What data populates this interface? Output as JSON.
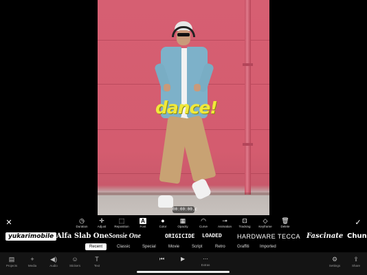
{
  "preview": {
    "overlay_text": "dance!",
    "timecode": "00:00:00.c",
    "colors": {
      "wall": "#d65f72",
      "overlay_text": "#f1e93a"
    }
  },
  "toolbar": {
    "close_icon": "close-icon",
    "done_icon": "checkmark-icon",
    "tools": [
      {
        "label": "Duration",
        "icon": "clock-icon",
        "glyph": "◷"
      },
      {
        "label": "Adjust",
        "icon": "move-icon",
        "glyph": "✛"
      },
      {
        "label": "Reposition",
        "icon": "crop-icon",
        "glyph": "⬚"
      },
      {
        "label": "Font",
        "icon": "font-icon",
        "glyph": "A"
      },
      {
        "label": "Color",
        "icon": "droplet-icon",
        "glyph": "●"
      },
      {
        "label": "Opacity",
        "icon": "checkerboard-icon",
        "glyph": "▦"
      },
      {
        "label": "Curve",
        "icon": "curve-icon",
        "glyph": "◠"
      },
      {
        "label": "Animation",
        "icon": "toggle-icon",
        "glyph": "⊸"
      },
      {
        "label": "Tracking",
        "icon": "tracking-icon",
        "glyph": "⊡"
      },
      {
        "label": "Keyframe",
        "icon": "tag-icon",
        "glyph": "◇"
      },
      {
        "label": "Delete",
        "icon": "trash-icon",
        "glyph": "🗑"
      }
    ],
    "active_tool": "Font"
  },
  "fonts": {
    "items": [
      "yukarimobile",
      "Alfa Slab One",
      "Sonsie One",
      "ORIGICIDE",
      "LOADED",
      "HARDWARE TECCA",
      "Fascinate",
      "Chunk"
    ],
    "selected": "yukarimobile"
  },
  "categories": {
    "items": [
      "Recent",
      "Classic",
      "Special",
      "Movie",
      "Script",
      "Retro",
      "Graffiti",
      "Imported"
    ],
    "active": "Recent"
  },
  "bottom_nav": {
    "left": [
      {
        "label": "Projects",
        "icon": "projects-icon",
        "glyph": "▤"
      },
      {
        "label": "Media",
        "icon": "plus-icon",
        "glyph": "+"
      },
      {
        "label": "Audio",
        "icon": "speaker-icon",
        "glyph": "◀)"
      },
      {
        "label": "Stickers",
        "icon": "smiley-icon",
        "glyph": "☺"
      },
      {
        "label": "Text",
        "icon": "text-icon",
        "glyph": "T"
      }
    ],
    "center": {
      "prev_icon": "skip-back-icon",
      "play_icon": "play-icon",
      "next_icon": "skip-forward-icon",
      "extra_label": "Extras"
    },
    "right": [
      {
        "label": "Settings",
        "icon": "gear-icon",
        "glyph": "⚙"
      },
      {
        "label": "Share",
        "icon": "share-icon",
        "glyph": "⇪"
      }
    ]
  }
}
